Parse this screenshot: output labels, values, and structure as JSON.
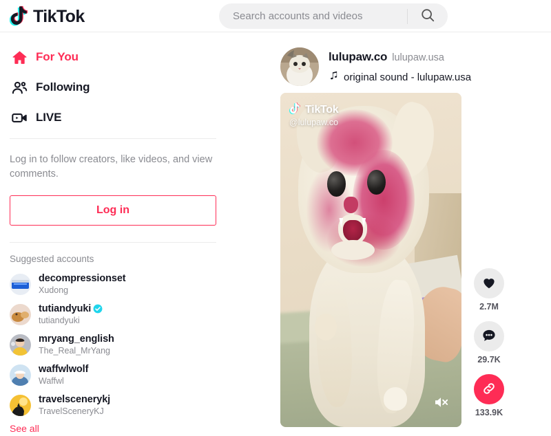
{
  "brand": {
    "name": "TikTok",
    "accent": "#fe2c55",
    "logo_cyan": "#25f4ee",
    "logo_magenta": "#fe2c55"
  },
  "search": {
    "placeholder": "Search accounts and videos",
    "value": "",
    "icon": "search-icon"
  },
  "sidebar": {
    "nav": [
      {
        "label": "For You",
        "icon": "home-icon",
        "active": true
      },
      {
        "label": "Following",
        "icon": "people-icon",
        "active": false
      },
      {
        "label": "LIVE",
        "icon": "live-video-icon",
        "active": false
      }
    ],
    "login_note": "Log in to follow creators, like videos, and view comments.",
    "login_button": "Log in",
    "suggested_title": "Suggested accounts",
    "suggested": [
      {
        "username": "decompressionset",
        "nickname": "Xudong",
        "verified": false,
        "avatar_colors": [
          "#d8e4f0",
          "#1d5fd6"
        ]
      },
      {
        "username": "tutiandyuki",
        "nickname": "tutiandyuki",
        "verified": true,
        "avatar_colors": [
          "#e9cfc2",
          "#c98a3f"
        ]
      },
      {
        "username": "mryang_english",
        "nickname": "The_Real_MrYang",
        "verified": false,
        "avatar_colors": [
          "#b9bcc4",
          "#f2c335"
        ]
      },
      {
        "username": "waffwlwolf",
        "nickname": "Waffwl",
        "verified": false,
        "avatar_colors": [
          "#cfe3f2",
          "#4f7fb0"
        ]
      },
      {
        "username": "travelscenerykj",
        "nickname": "TravelSceneryKJ",
        "verified": false,
        "avatar_colors": [
          "#f5c033",
          "#1a1a1a"
        ]
      }
    ],
    "see_all": "See all"
  },
  "post": {
    "username": "lulupaw.co",
    "nickname": "lulupaw.usa",
    "music_icon": "music-note-icon",
    "music_label": "original sound - lulupaw.usa",
    "video": {
      "watermark_text": "TikTok",
      "handle": "@lulupaw.co",
      "muted": true,
      "mute_icon": "speaker-muted-icon"
    },
    "actions": [
      {
        "name": "like",
        "icon": "heart-icon",
        "count": "2.7M"
      },
      {
        "name": "comment",
        "icon": "comment-icon",
        "count": "29.7K"
      },
      {
        "name": "share",
        "icon": "link-icon",
        "count": "133.9K"
      }
    ]
  }
}
